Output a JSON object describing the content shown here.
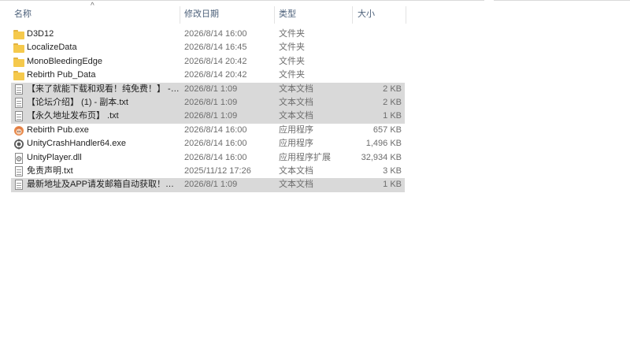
{
  "columns": {
    "name": "名称",
    "date": "修改日期",
    "type": "类型",
    "size": "大小"
  },
  "sort_indicator": "^",
  "files": [
    {
      "name": "D3D12",
      "date": "2026/8/14 16:00",
      "type": "文件夹",
      "size": "",
      "icon": "folder-icon",
      "selected": false
    },
    {
      "name": "LocalizeData",
      "date": "2026/8/14 16:45",
      "type": "文件夹",
      "size": "",
      "icon": "folder-icon",
      "selected": false
    },
    {
      "name": "MonoBleedingEdge",
      "date": "2026/8/14 20:42",
      "type": "文件夹",
      "size": "",
      "icon": "folder-icon",
      "selected": false
    },
    {
      "name": "Rebirth Pub_Data",
      "date": "2026/8/14 20:42",
      "type": "文件夹",
      "size": "",
      "icon": "folder-icon",
      "selected": false
    },
    {
      "name": "【来了就能下载和观看！纯免费！】 - 副...",
      "date": "2026/8/1 1:09",
      "type": "文本文档",
      "size": "2 KB",
      "icon": "text-file-icon",
      "selected": true
    },
    {
      "name": "【论坛介绍】 (1) - 副本.txt",
      "date": "2026/8/1 1:09",
      "type": "文本文档",
      "size": "2 KB",
      "icon": "text-file-icon",
      "selected": true
    },
    {
      "name": "【永久地址发布页】 .txt",
      "date": "2026/8/1 1:09",
      "type": "文本文档",
      "size": "1 KB",
      "icon": "text-file-icon",
      "selected": true
    },
    {
      "name": "Rebirth Pub.exe",
      "date": "2026/8/14 16:00",
      "type": "应用程序",
      "size": "657 KB",
      "icon": "app-character-icon",
      "selected": false
    },
    {
      "name": "UnityCrashHandler64.exe",
      "date": "2026/8/14 16:00",
      "type": "应用程序",
      "size": "1,496 KB",
      "icon": "unity-gear-icon",
      "selected": false
    },
    {
      "name": "UnityPlayer.dll",
      "date": "2026/8/14 16:00",
      "type": "应用程序扩展",
      "size": "32,934 KB",
      "icon": "dll-file-icon",
      "selected": false
    },
    {
      "name": "免责声明.txt",
      "date": "2025/11/12 17:26",
      "type": "文本文档",
      "size": "3 KB",
      "icon": "text-file-icon",
      "selected": false
    },
    {
      "name": "最新地址及APP请发邮箱自动获取！！！...",
      "date": "2026/8/1 1:09",
      "type": "文本文档",
      "size": "1 KB",
      "icon": "text-file-icon",
      "selected": true
    }
  ]
}
